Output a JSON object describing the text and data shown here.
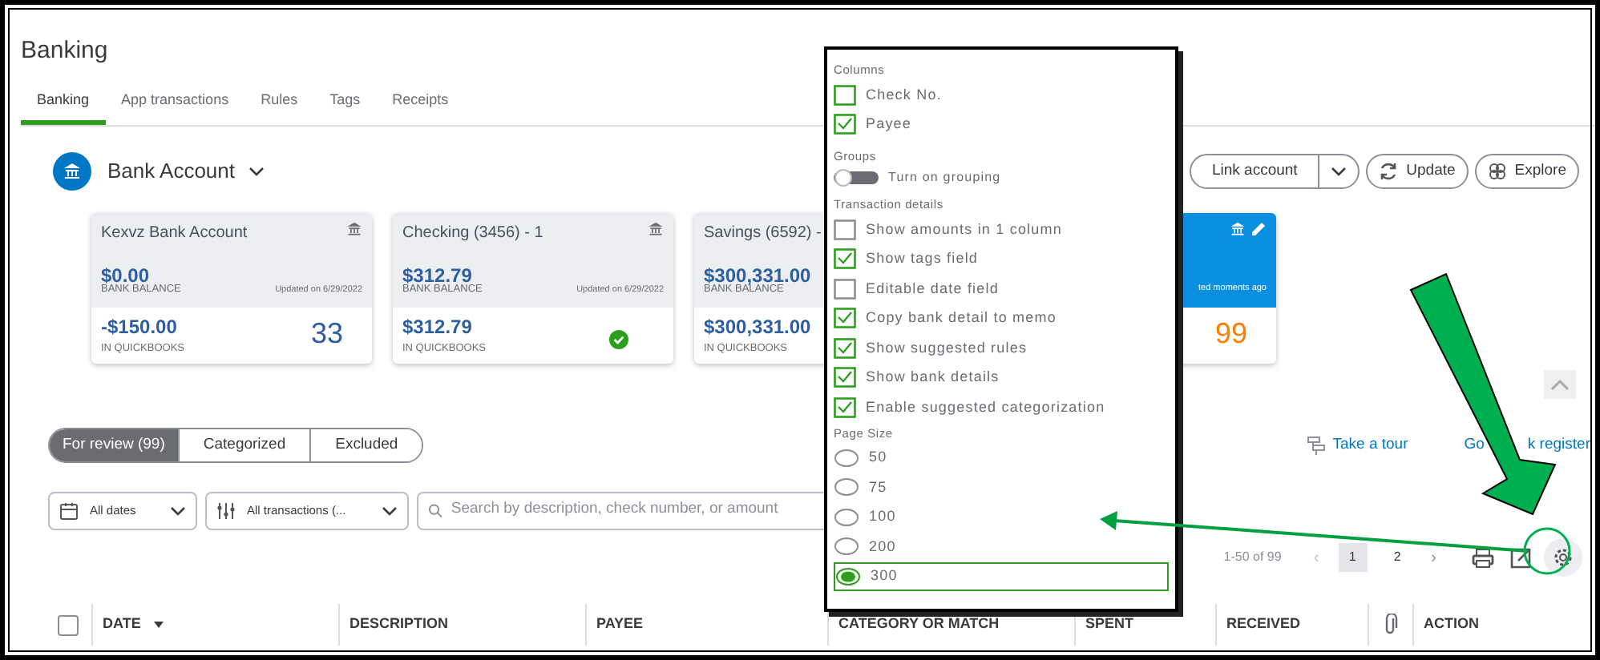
{
  "page_title": "Banking",
  "tabs": [
    {
      "label": "Banking",
      "selected": true
    },
    {
      "label": "App transactions",
      "selected": false
    },
    {
      "label": "Rules",
      "selected": false
    },
    {
      "label": "Tags",
      "selected": false
    },
    {
      "label": "Receipts",
      "selected": false
    }
  ],
  "account_selector": {
    "label": "Bank Account"
  },
  "header_buttons": [
    {
      "kind": "split",
      "label": "Link account"
    },
    {
      "kind": "update",
      "label": "Update"
    },
    {
      "kind": "explore",
      "label": "Explore"
    }
  ],
  "cards": [
    {
      "name": "Kexvz Bank Account",
      "bank_balance": "$0.00",
      "bank_label": "BANK BALANCE",
      "updated": "Updated on 6/29/2022",
      "qb_balance": "-$150.00",
      "qb_label": "IN QUICKBOOKS",
      "count": "33",
      "reconciled": false,
      "selected": false,
      "icons": [
        {
          "kind": "bank"
        }
      ]
    },
    {
      "name": "Checking (3456) - 1",
      "bank_balance": "$312.79",
      "bank_label": "BANK BALANCE",
      "updated": "Updated on 6/29/2022",
      "qb_balance": "$312.79",
      "qb_label": "IN QUICKBOOKS",
      "reconciled": true,
      "selected": false,
      "icons": [
        {
          "kind": "bank"
        }
      ]
    },
    {
      "name": "Savings (6592) -",
      "bank_balance": "$300,331.00",
      "bank_label": "BANK BALANCE",
      "qb_balance": "$300,331.00",
      "qb_label": "IN QUICKBOOKS",
      "reconciled": false,
      "selected": false
    },
    {
      "updated": "ted moments ago",
      "count": "99",
      "reconciled": false,
      "selected": true,
      "icons": [
        {
          "kind": "bank"
        },
        {
          "kind": "pencil"
        }
      ]
    }
  ],
  "review_tabs": [
    {
      "label": "For review (99)",
      "selected": true
    },
    {
      "label": "Categorized",
      "selected": false
    },
    {
      "label": "Excluded",
      "selected": false
    }
  ],
  "links": [
    {
      "kind": "tour",
      "label": "Take a tour"
    },
    {
      "kind": "text",
      "label": "Go"
    },
    {
      "kind": "text",
      "label": "k register"
    }
  ],
  "filters": [
    {
      "kind": "date",
      "label": "All dates"
    },
    {
      "kind": "type",
      "label": "All transactions (..."
    }
  ],
  "search": {
    "placeholder": "Search by description, check number, or amount"
  },
  "pagination": {
    "range": "1-50 of 99",
    "prev": "‹",
    "next": "›",
    "pages": [
      {
        "label": "1",
        "selected": true
      },
      {
        "label": "2",
        "selected": false
      }
    ]
  },
  "table": {
    "columns": [
      {
        "kind": "check",
        "checked": false
      },
      {
        "kind": "text",
        "label": "DATE",
        "sorted": true
      },
      {
        "kind": "text",
        "label": "DESCRIPTION"
      },
      {
        "kind": "text",
        "label": "PAYEE"
      },
      {
        "kind": "text",
        "label": "CATEGORY OR MATCH"
      },
      {
        "kind": "text",
        "label": "SPENT"
      },
      {
        "kind": "text",
        "label": "RECEIVED"
      },
      {
        "kind": "clip"
      },
      {
        "kind": "text",
        "label": "ACTION"
      }
    ]
  },
  "settings_menu": {
    "sections": [
      {
        "heading": "Columns",
        "items": [
          {
            "kind": "checkbox",
            "label": "Check No.",
            "checked": false
          },
          {
            "kind": "checkbox",
            "label": "Payee",
            "checked": true
          }
        ]
      },
      {
        "heading": "Groups",
        "items": [
          {
            "kind": "toggle",
            "label": "Turn on grouping",
            "on": false
          }
        ]
      },
      {
        "heading": "Transaction details",
        "items": [
          {
            "kind": "checkbox",
            "label": "Show amounts in 1 column",
            "checked": false
          },
          {
            "kind": "checkbox",
            "label": "Show tags field",
            "checked": true
          },
          {
            "kind": "checkbox",
            "label": "Editable date field",
            "checked": false
          },
          {
            "kind": "checkbox",
            "label": "Copy bank detail to memo",
            "checked": true
          },
          {
            "kind": "checkbox",
            "label": "Show suggested rules",
            "checked": true
          },
          {
            "kind": "checkbox",
            "label": "Show bank details",
            "checked": true
          },
          {
            "kind": "checkbox",
            "label": "Enable suggested categorization",
            "checked": true
          }
        ]
      },
      {
        "heading": "Page Size",
        "items": [
          {
            "kind": "radio",
            "label": "50",
            "selected": false
          },
          {
            "kind": "radio",
            "label": "75",
            "selected": false
          },
          {
            "kind": "radio",
            "label": "100",
            "selected": false
          },
          {
            "kind": "radio",
            "label": "200",
            "selected": false
          },
          {
            "kind": "radio",
            "label": "300",
            "selected": true
          }
        ]
      }
    ]
  }
}
